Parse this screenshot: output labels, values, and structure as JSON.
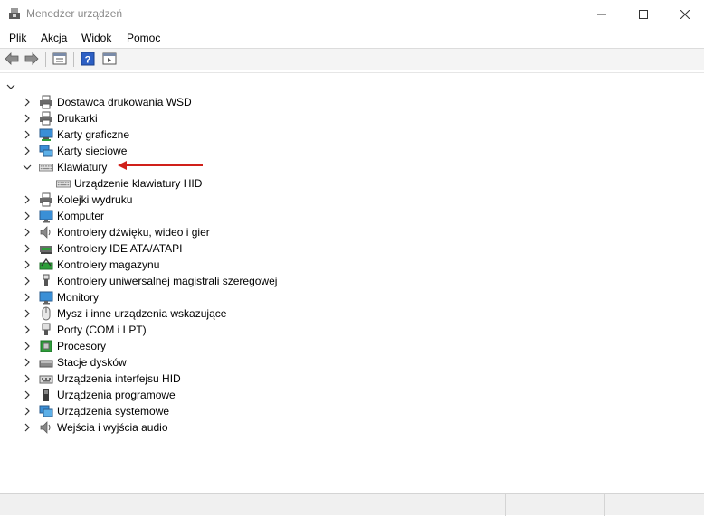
{
  "window": {
    "title": "Menedżer urządzeń"
  },
  "menu": {
    "file": "Plik",
    "action": "Akcja",
    "view": "Widok",
    "help": "Pomoc"
  },
  "toolbar": {
    "buttons": [
      "back-icon",
      "forward-icon",
      "properties-icon",
      "help-icon",
      "update-driver-icon"
    ]
  },
  "tree": {
    "root_expanded": true,
    "items": [
      {
        "label": "Dostawca drukowania WSD",
        "icon": "printer-icon",
        "expanded": false
      },
      {
        "label": "Drukarki",
        "icon": "printer-icon",
        "expanded": false
      },
      {
        "label": "Karty graficzne",
        "icon": "display-adapter-icon",
        "expanded": false
      },
      {
        "label": "Karty sieciowe",
        "icon": "network-adapter-icon",
        "expanded": false
      },
      {
        "label": "Klawiatury",
        "icon": "keyboard-icon",
        "expanded": true,
        "children": [
          {
            "label": "Urządzenie klawiatury HID",
            "icon": "keyboard-icon"
          }
        ]
      },
      {
        "label": "Kolejki wydruku",
        "icon": "print-queue-icon",
        "expanded": false
      },
      {
        "label": "Komputer",
        "icon": "computer-icon",
        "expanded": false
      },
      {
        "label": "Kontrolery dźwięku, wideo i gier",
        "icon": "speaker-icon",
        "expanded": false
      },
      {
        "label": "Kontrolery IDE ATA/ATAPI",
        "icon": "ide-controller-icon",
        "expanded": false
      },
      {
        "label": "Kontrolery magazynu",
        "icon": "storage-controller-icon",
        "expanded": false
      },
      {
        "label": "Kontrolery uniwersalnej magistrali szeregowej",
        "icon": "usb-icon",
        "expanded": false
      },
      {
        "label": "Monitory",
        "icon": "monitor-icon",
        "expanded": false
      },
      {
        "label": "Mysz i inne urządzenia wskazujące",
        "icon": "mouse-icon",
        "expanded": false
      },
      {
        "label": "Porty (COM i LPT)",
        "icon": "port-icon",
        "expanded": false
      },
      {
        "label": "Procesory",
        "icon": "processor-icon",
        "expanded": false
      },
      {
        "label": "Stacje dysków",
        "icon": "disk-drive-icon",
        "expanded": false
      },
      {
        "label": "Urządzenia interfejsu HID",
        "icon": "hid-icon",
        "expanded": false
      },
      {
        "label": "Urządzenia programowe",
        "icon": "software-device-icon",
        "expanded": false
      },
      {
        "label": "Urządzenia systemowe",
        "icon": "system-device-icon",
        "expanded": false
      },
      {
        "label": "Wejścia i wyjścia audio",
        "icon": "audio-io-icon",
        "expanded": false
      }
    ]
  },
  "annotation": {
    "arrow_color": "#d0201a"
  },
  "colors": {
    "title_text": "#8a8a8a",
    "toolbar_bg": "#f4f4f4",
    "statusbar_bg": "#f0f0f0"
  }
}
